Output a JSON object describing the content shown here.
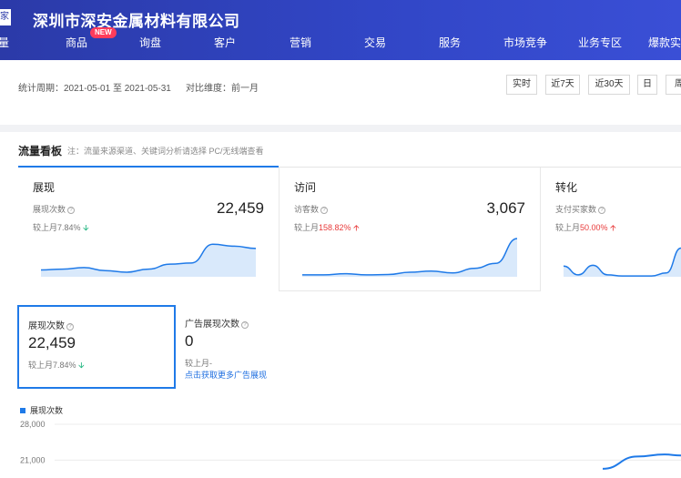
{
  "header": {
    "company": "深圳市深安金属材料有限公司",
    "logo_glyph": "家",
    "nav": [
      {
        "label": "量"
      },
      {
        "label": "商品",
        "badge": "NEW"
      },
      {
        "label": "询盘"
      },
      {
        "label": "客户"
      },
      {
        "label": "营销"
      },
      {
        "label": "交易"
      },
      {
        "label": "服务"
      },
      {
        "label": "市场竞争"
      },
      {
        "label": "业务专区"
      },
      {
        "label": "爆款实"
      }
    ]
  },
  "period": {
    "label": "统计周期：",
    "start": "2021-05-01",
    "to": "至",
    "end": "2021-05-31",
    "compare_label": "对比维度：",
    "compare_value": "前一月",
    "buttons": [
      "实时",
      "近7天",
      "近30天",
      "日",
      "周"
    ]
  },
  "dashboard": {
    "title": "流量看板",
    "note": "注：流量来源渠道、关键词分析请选择 PC/无线端查看",
    "cards": [
      {
        "title": "展现",
        "sub": "展现次数",
        "value": "22,459",
        "cmp_prefix": "较上月",
        "cmp_value": "7.84%",
        "direction": "down",
        "spark": [
          0.18,
          0.2,
          0.24,
          0.16,
          0.12,
          0.2,
          0.33,
          0.36,
          0.85,
          0.8,
          0.74
        ]
      },
      {
        "title": "访问",
        "sub": "访客数",
        "value": "3,067",
        "cmp_prefix": "较上月",
        "cmp_value": "158.82%",
        "direction": "up",
        "spark": [
          0.05,
          0.05,
          0.08,
          0.05,
          0.06,
          0.12,
          0.15,
          0.1,
          0.22,
          0.35,
          1.0
        ]
      },
      {
        "title": "转化",
        "sub": "支付买家数",
        "value": "",
        "cmp_prefix": "较上月",
        "cmp_value": "50.00%",
        "direction": "up",
        "spark": [
          0.28,
          0.05,
          0.3,
          0.05,
          0.02,
          0.02,
          0.02,
          0.1,
          0.75,
          0.4
        ]
      }
    ]
  },
  "indicators": [
    {
      "title": "展现次数",
      "value": "22,459",
      "cmp_prefix": "较上月",
      "cmp_value": "7.84%",
      "direction": "down"
    },
    {
      "title": "广告展现次数",
      "value": "0",
      "cmp_prefix": "较上月",
      "cmp_value": "-",
      "link": "点击获取更多广告展现"
    }
  ],
  "chart_data": {
    "type": "line",
    "series": [
      {
        "name": "展现次数",
        "values": [
          19300,
          21700,
          22100,
          21900
        ]
      }
    ],
    "y_ticks": [
      "28,000",
      "21,000"
    ],
    "ylim": [
      17500,
      28000
    ]
  },
  "colors": {
    "accent": "#1f7ae8",
    "up": "#e83a3a",
    "down": "#19b37c",
    "header": "#3146c6"
  }
}
